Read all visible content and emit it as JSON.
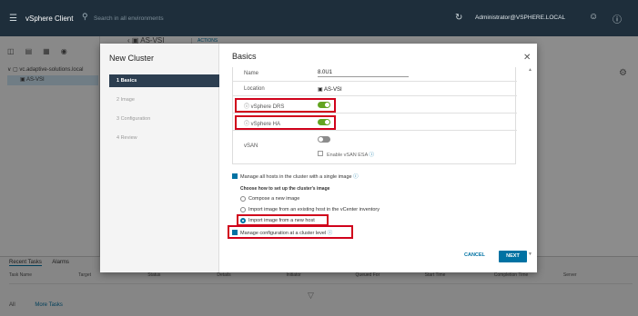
{
  "topbar": {
    "app_title": "vSphere Client",
    "search_placeholder": "Search in all environments",
    "user": "Administrator@VSPHERE.LOCAL"
  },
  "navigator": {
    "vcenter": "vc.adaptive-solutions.local",
    "datacenter": "AS-VSI"
  },
  "object_header": {
    "title": "AS-VSI",
    "actions": "ACTIONS"
  },
  "bottom_panel": {
    "tabs": [
      "Recent Tasks",
      "Alarms"
    ],
    "columns": [
      "Task Name",
      "Target",
      "Status",
      "Details",
      "Initiator",
      "Queued For",
      "Start Time",
      "Completion Time",
      "Server"
    ],
    "filter": "All",
    "more_tasks": "More Tasks"
  },
  "wizard": {
    "title": "New Cluster",
    "steps": [
      "1  Basics",
      "2  Image",
      "3  Configuration",
      "4  Review"
    ],
    "active_step": 0,
    "page_title": "Basics",
    "fields": {
      "name_label": "Name",
      "name_value": "8.0U1",
      "location_label": "Location",
      "location_value": "AS-VSI",
      "drs_label": "vSphere DRS",
      "drs_on": true,
      "ha_label": "vSphere HA",
      "ha_on": true,
      "vsan_label": "vSAN",
      "vsan_on": false,
      "vsan_esa_label": "Enable vSAN ESA"
    },
    "manage_image_label": "Manage all hosts in the cluster with a single image",
    "image_setup_heading": "Choose how to set up the cluster's image",
    "image_options": [
      "Compose a new image",
      "Import image from an existing host in the vCenter inventory",
      "Import image from a new host"
    ],
    "selected_option": 2,
    "manage_config_label": "Manage configuration at a cluster level",
    "cancel_label": "CANCEL",
    "next_label": "NEXT"
  },
  "colors": {
    "accent": "#0072a3",
    "toggle_on": "#62a420",
    "highlight": "#d0021b",
    "header_bg": "#1e2e3b"
  }
}
